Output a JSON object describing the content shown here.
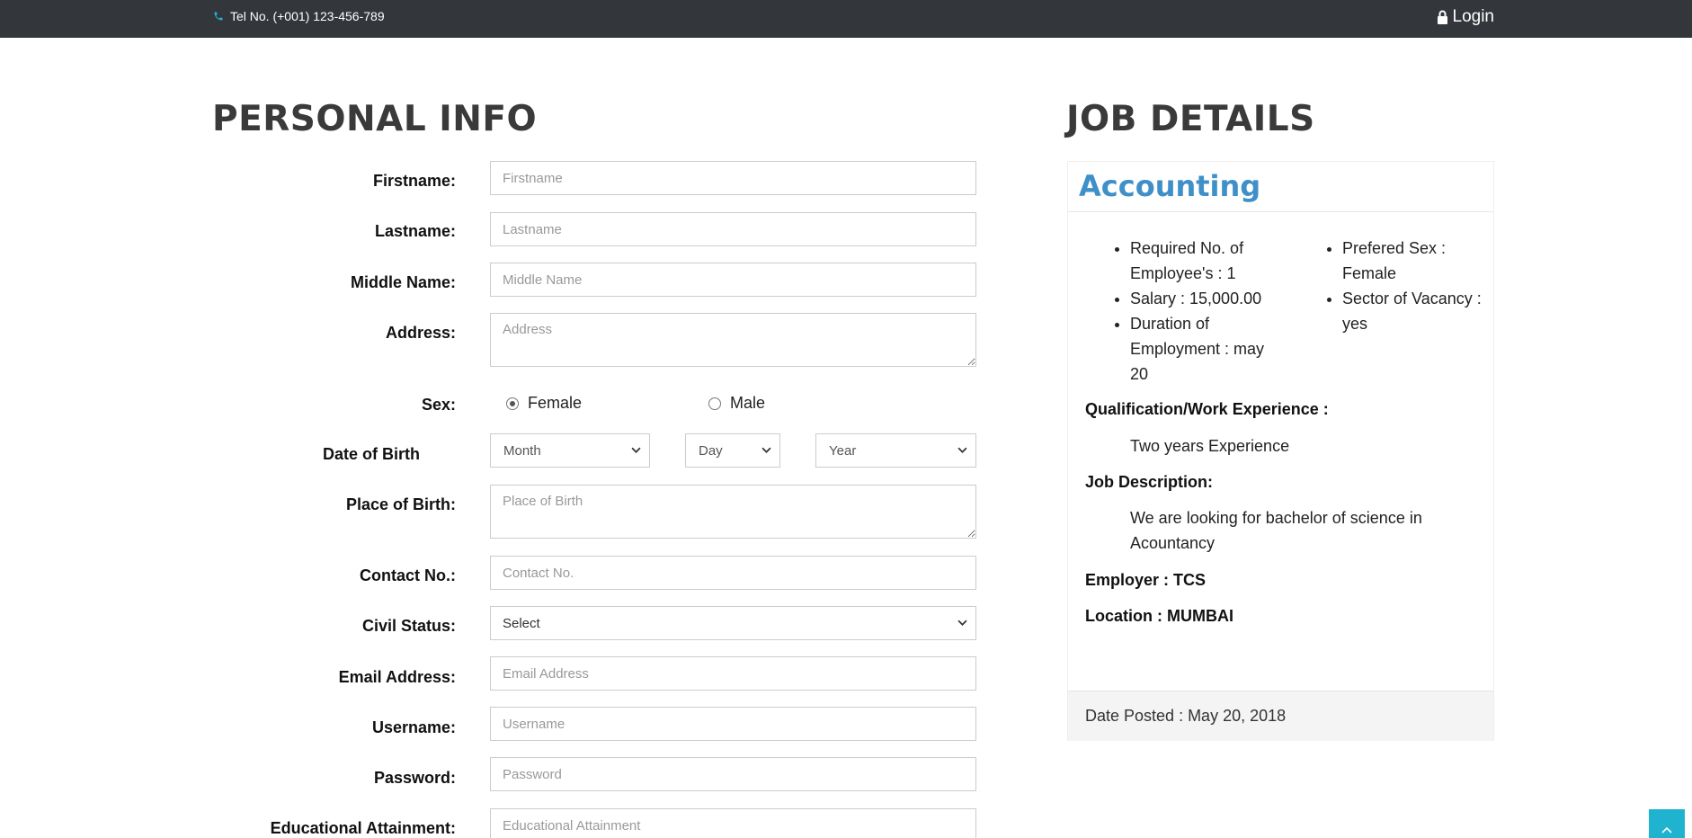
{
  "topbar": {
    "tel": "Tel No. (+001) 123-456-789",
    "login": "Login"
  },
  "personal": {
    "title": "PERSONAL INFO",
    "fields": {
      "firstname": {
        "label": "Firstname:",
        "placeholder": "Firstname"
      },
      "lastname": {
        "label": "Lastname:",
        "placeholder": "Lastname"
      },
      "middlename": {
        "label": "Middle Name:",
        "placeholder": "Middle Name"
      },
      "address": {
        "label": "Address:",
        "placeholder": "Address"
      },
      "sex": {
        "label": "Sex:",
        "female": "Female",
        "male": "Male",
        "selected": "Female"
      },
      "dob": {
        "label": "Date of Birth",
        "month": "Month",
        "day": "Day",
        "year": "Year"
      },
      "pob": {
        "label": "Place of Birth:",
        "placeholder": "Place of Birth"
      },
      "contact": {
        "label": "Contact No.:",
        "placeholder": "Contact No."
      },
      "civil": {
        "label": "Civil Status:",
        "selected": "Select"
      },
      "email": {
        "label": "Email Address:",
        "placeholder": "Email Address"
      },
      "username": {
        "label": "Username:",
        "placeholder": "Username"
      },
      "password": {
        "label": "Password:",
        "placeholder": "Password"
      },
      "education": {
        "label": "Educational Attainment:",
        "placeholder": "Educational Attainment"
      }
    }
  },
  "job": {
    "title": "JOB DETAILS",
    "card": {
      "title": "Accounting",
      "left_items": [
        "Required No. of Employee's : 1",
        "Salary : 15,000.00",
        "Duration of Employment : may 20"
      ],
      "right_items": [
        "Prefered Sex : Female",
        "Sector of Vacancy : yes"
      ],
      "qualification_label": "Qualification/Work Experience :",
      "qualification": "Two years Experience",
      "description_label": "Job Description:",
      "description": "We are looking for bachelor of science in Acountancy",
      "employer": "Employer : TCS",
      "location": "Location : MUMBAI",
      "date_posted": "Date Posted : May 20, 2018"
    }
  },
  "colors": {
    "topbar_bg": "#33363b",
    "accent_title": "#3f8fc9",
    "scroll_button": "#1fb3cf"
  }
}
